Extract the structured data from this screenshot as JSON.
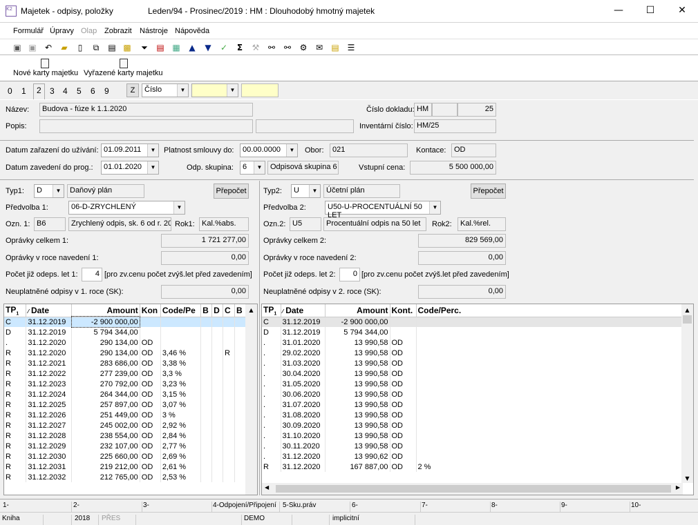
{
  "window": {
    "title": "Majetek - odpisy, položky",
    "subtitle": "Leden/94 - Prosinec/2019 : HM : Dlouhodobý hmotný majetek",
    "app_icon": "K2",
    "buttons": {
      "minimize": "—",
      "maximize": "☐",
      "close": "✕"
    }
  },
  "menu": [
    "Formulář",
    "Úpravy",
    "Olap",
    "Zobrazit",
    "Nástroje",
    "Nápověda"
  ],
  "toolbar_icons": [
    "save-icon",
    "save-as-icon",
    "undo-icon",
    "open-folder-icon",
    "new-doc-icon",
    "copy-icon",
    "document-icon",
    "lock-icon",
    "book-icon",
    "filter-icon",
    "filter-doc-icon",
    "books-icon",
    "arrow-up-icon",
    "arrow-down-icon",
    "check-arrow-icon",
    "sum-icon",
    "hammer-icon",
    "binoculars-icon",
    "binoculars2-icon",
    "tools-icon",
    "mail-icon",
    "notepad-icon",
    "menu-lines-icon"
  ],
  "bigbar": {
    "new_cards": "Nové karty majetku",
    "retired_cards": "Vyřazené karty majetku"
  },
  "tabs": [
    "0",
    "1",
    "2",
    "3",
    "4",
    "5",
    "6",
    "9"
  ],
  "tab_selected": "2",
  "filter": {
    "z_label": "Z",
    "combo_value": "Číslo",
    "field1": "",
    "field2": ""
  },
  "header": {
    "nazev_label": "Název:",
    "nazev": "Budova - fúze k 1.1.2020",
    "popis_label": "Popis:",
    "popis": "",
    "popis2": "",
    "cislo_dokladu_label": "Číslo dokladu:",
    "doklad_type": "HM",
    "doklad_mid": "",
    "doklad_num": "25",
    "inventarni_label": "Inventární číslo:",
    "inventarni": "HM/25"
  },
  "dates": {
    "datum_zarazeni_label": "Datum zařazení do užívání:",
    "datum_zarazeni": "01.09.2011",
    "platnost_label": "Platnost smlouvy do:",
    "platnost": "00.00.0000",
    "obor_label": "Obor:",
    "obor": "021",
    "kontace_label": "Kontace:",
    "kontace": "OD",
    "datum_zavedeni_label": "Datum zavedení do prog.:",
    "datum_zavedeni": "01.01.2020",
    "odp_skupina_label": "Odp. skupina:",
    "odp_skupina": "6",
    "odp_skupina_text": "Odpisová skupina 6 (",
    "vstupni_cena_label": "Vstupní cena:",
    "vstupni_cena": "5 500 000,00"
  },
  "left": {
    "typ_label": "Typ1:",
    "typ": "D",
    "typ_text": "Daňový plán",
    "prepocet": "Přepočet",
    "predvolba_label": "Předvolba 1:",
    "predvolba": "06-D-ZRYCHLENÝ",
    "ozn_label": "Ozn. 1:",
    "ozn": "B6",
    "ozn_text": "Zrychlený odpis, sk. 6 od r. 20",
    "rok_label": "Rok1:",
    "rok": "Kal.%abs.",
    "opravky_label": "Oprávky celkem 1:",
    "opravky": "1 721 277,00",
    "opravky_roce_label": "Oprávky v roce navedení 1:",
    "opravky_roce": "0,00",
    "pocet_label": "Počet již odeps. let 1:",
    "pocet": "4",
    "pocet_note": "[pro zv.cenu počet zvýš.let před zavedením]",
    "neuplatnene_label": "Neuplatněné odpisy v 1. roce (SK):",
    "neuplatnene": "0,00"
  },
  "right": {
    "typ_label": "Typ2:",
    "typ": "U",
    "typ_text": "Účetní plán",
    "prepocet": "Přepočet",
    "predvolba_label": "Předvolba 2:",
    "predvolba": "U50-U-PROCENTUÁLNÍ 50 LET",
    "ozn_label": "Ozn.2:",
    "ozn": "U5",
    "ozn_text": "Procentuální odpis na 50 let",
    "rok_label": "Rok2:",
    "rok": "Kal.%rel.",
    "opravky_label": "Oprávky celkem 2:",
    "opravky": "829 569,00",
    "opravky_roce_label": "Oprávky v roce navedení 2:",
    "opravky_roce": "0,00",
    "pocet_label": "Počet již odeps. let 2:",
    "pocet": "0",
    "pocet_note": "[pro zv.cenu počet zvýš.let před zavedením]",
    "neuplatnene_label": "Neuplatněné odpisy v 2. roce (SK):",
    "neuplatnene": "0,00"
  },
  "grid_left": {
    "columns": [
      "TP",
      "Date",
      "Amount",
      "Kon",
      "Code/Pe",
      "B",
      "D",
      "C",
      "B"
    ],
    "tp_sub": "1",
    "rows": [
      [
        "C",
        "31.12.2019",
        "-2 900 000,00",
        "",
        "",
        "",
        "",
        "",
        ""
      ],
      [
        "D",
        "31.12.2019",
        "5 794 344,00",
        "",
        "",
        "",
        "",
        "",
        ""
      ],
      [
        ".",
        "31.12.2020",
        "290 134,00",
        "OD",
        "",
        "",
        "",
        "",
        ""
      ],
      [
        "R",
        "31.12.2020",
        "290 134,00",
        "OD",
        "3,46 %",
        "",
        "",
        "R",
        ""
      ],
      [
        "R",
        "31.12.2021",
        "283 686,00",
        "OD",
        "3,38 %",
        "",
        "",
        "",
        ""
      ],
      [
        "R",
        "31.12.2022",
        "277 239,00",
        "OD",
        "3,3 %",
        "",
        "",
        "",
        ""
      ],
      [
        "R",
        "31.12.2023",
        "270 792,00",
        "OD",
        "3,23 %",
        "",
        "",
        "",
        ""
      ],
      [
        "R",
        "31.12.2024",
        "264 344,00",
        "OD",
        "3,15 %",
        "",
        "",
        "",
        ""
      ],
      [
        "R",
        "31.12.2025",
        "257 897,00",
        "OD",
        "3,07 %",
        "",
        "",
        "",
        ""
      ],
      [
        "R",
        "31.12.2026",
        "251 449,00",
        "OD",
        "3 %",
        "",
        "",
        "",
        ""
      ],
      [
        "R",
        "31.12.2027",
        "245 002,00",
        "OD",
        "2,92 %",
        "",
        "",
        "",
        ""
      ],
      [
        "R",
        "31.12.2028",
        "238 554,00",
        "OD",
        "2,84 %",
        "",
        "",
        "",
        ""
      ],
      [
        "R",
        "31.12.2029",
        "232 107,00",
        "OD",
        "2,77 %",
        "",
        "",
        "",
        ""
      ],
      [
        "R",
        "31.12.2030",
        "225 660,00",
        "OD",
        "2,69 %",
        "",
        "",
        "",
        ""
      ],
      [
        "R",
        "31.12.2031",
        "219 212,00",
        "OD",
        "2,61 %",
        "",
        "",
        "",
        ""
      ],
      [
        "R",
        "31.12.2032",
        "212 765,00",
        "OD",
        "2,53 %",
        "",
        "",
        "",
        ""
      ]
    ]
  },
  "grid_right": {
    "columns": [
      "TP",
      "Date",
      "Amount",
      "Kont.",
      "Code/Perc."
    ],
    "tp_sub": "1",
    "rows": [
      [
        "C",
        "31.12.2019",
        "-2 900 000,00",
        "",
        ""
      ],
      [
        "D",
        "31.12.2019",
        "5 794 344,00",
        "",
        ""
      ],
      [
        ".",
        "31.01.2020",
        "13 990,58",
        "OD",
        ""
      ],
      [
        ".",
        "29.02.2020",
        "13 990,58",
        "OD",
        ""
      ],
      [
        ".",
        "31.03.2020",
        "13 990,58",
        "OD",
        ""
      ],
      [
        ".",
        "30.04.2020",
        "13 990,58",
        "OD",
        ""
      ],
      [
        ".",
        "31.05.2020",
        "13 990,58",
        "OD",
        ""
      ],
      [
        ".",
        "30.06.2020",
        "13 990,58",
        "OD",
        ""
      ],
      [
        ".",
        "31.07.2020",
        "13 990,58",
        "OD",
        ""
      ],
      [
        ".",
        "31.08.2020",
        "13 990,58",
        "OD",
        ""
      ],
      [
        ".",
        "30.09.2020",
        "13 990,58",
        "OD",
        ""
      ],
      [
        ".",
        "31.10.2020",
        "13 990,58",
        "OD",
        ""
      ],
      [
        ".",
        "30.11.2020",
        "13 990,58",
        "OD",
        ""
      ],
      [
        ".",
        "31.12.2020",
        "13 990,62",
        "OD",
        ""
      ],
      [
        "R",
        "31.12.2020",
        "167 887,00",
        "OD",
        "2 %"
      ]
    ]
  },
  "fkeys": [
    "1-",
    "2-",
    "3-",
    "4-Odpojení/Připojení",
    "5-Sku.práv",
    "6-",
    "7-",
    "8-",
    "9-",
    "10-"
  ],
  "status": [
    "Kniha",
    "",
    "2018",
    "PŘES",
    "",
    "DEMO",
    "",
    "implicitní"
  ],
  "colors": {
    "selected_row": "#cce8ff",
    "current_row": "#e5e5e5"
  }
}
